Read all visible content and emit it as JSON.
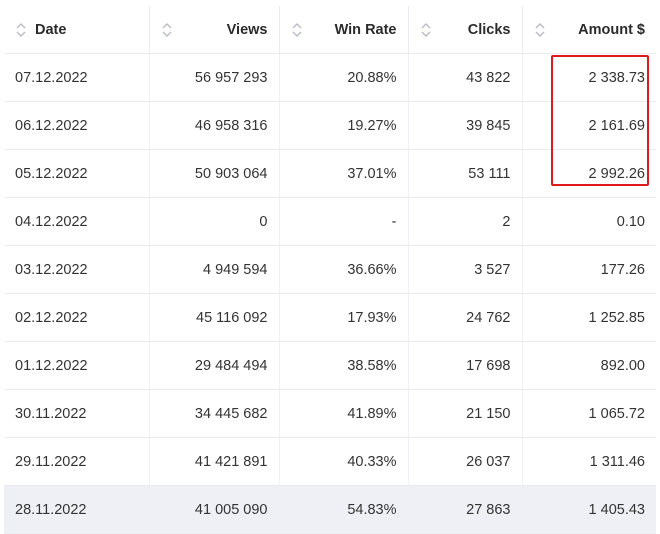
{
  "table": {
    "columns": [
      {
        "key": "date",
        "label": "Date",
        "align": "left"
      },
      {
        "key": "views",
        "label": "Views",
        "align": "right"
      },
      {
        "key": "win_rate",
        "label": "Win Rate",
        "align": "right"
      },
      {
        "key": "clicks",
        "label": "Clicks",
        "align": "right"
      },
      {
        "key": "amount",
        "label": "Amount $",
        "align": "right"
      }
    ],
    "rows": [
      {
        "date": "07.12.2022",
        "views": "56 957 293",
        "win_rate": "20.88%",
        "clicks": "43 822",
        "amount": "2 338.73"
      },
      {
        "date": "06.12.2022",
        "views": "46 958 316",
        "win_rate": "19.27%",
        "clicks": "39 845",
        "amount": "2 161.69"
      },
      {
        "date": "05.12.2022",
        "views": "50 903 064",
        "win_rate": "37.01%",
        "clicks": "53 111",
        "amount": "2 992.26"
      },
      {
        "date": "04.12.2022",
        "views": "0",
        "win_rate": "-",
        "clicks": "2",
        "amount": "0.10"
      },
      {
        "date": "03.12.2022",
        "views": "4 949 594",
        "win_rate": "36.66%",
        "clicks": "3 527",
        "amount": "177.26"
      },
      {
        "date": "02.12.2022",
        "views": "45 116 092",
        "win_rate": "17.93%",
        "clicks": "24 762",
        "amount": "1 252.85"
      },
      {
        "date": "01.12.2022",
        "views": "29 484 494",
        "win_rate": "38.58%",
        "clicks": "17 698",
        "amount": "892.00"
      },
      {
        "date": "30.11.2022",
        "views": "34 445 682",
        "win_rate": "41.89%",
        "clicks": "21 150",
        "amount": "1 065.72"
      },
      {
        "date": "29.11.2022",
        "views": "41 421 891",
        "win_rate": "40.33%",
        "clicks": "26 037",
        "amount": "1 311.46"
      },
      {
        "date": "28.11.2022",
        "views": "41 005 090",
        "win_rate": "54.83%",
        "clicks": "27 863",
        "amount": "1 405.43"
      }
    ],
    "highlighted_row_index": 9
  },
  "annotation": {
    "color": "#e0191f",
    "target": "amount column, rows 1-3"
  },
  "colors": {
    "grid": "#e9ebef",
    "highlight_row": "#eef0f5",
    "sort_icon": "#b8bcc4"
  },
  "icons": {
    "sort": "sort-updown-icon"
  }
}
